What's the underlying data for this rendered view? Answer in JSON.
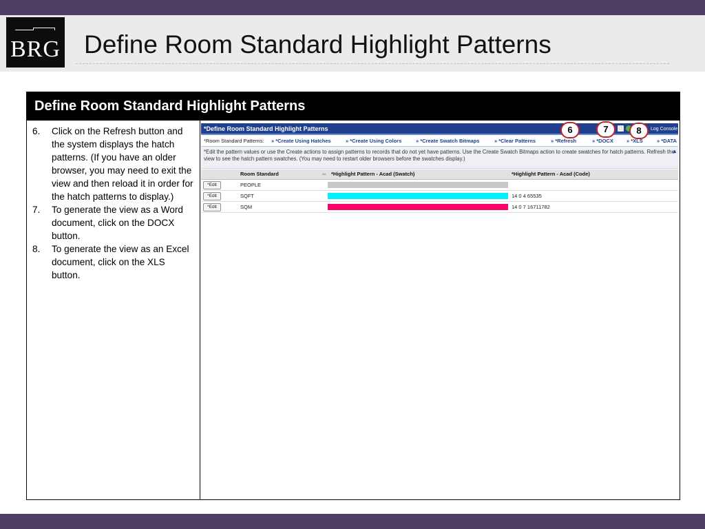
{
  "slide": {
    "title": "Define Room Standard Highlight Patterns",
    "logo_text": "BRG",
    "content_header": "Define Room Standard Highlight Patterns",
    "steps": [
      {
        "num": "6.",
        "text": "Click on the Refresh button and the system displays the hatch patterns. (If you have an older browser, you may need to exit the view and then reload it in order for the hatch patterns to display.)"
      },
      {
        "num": "7.",
        "text": "To generate the view as a Word document, click on the DOCX button."
      },
      {
        "num": "8.",
        "text": "To generate the view as an Excel document, click on the XLS button."
      }
    ]
  },
  "screenshot": {
    "title": "*Define Room Standard Highlight Patterns",
    "log_console": "Log Console",
    "actions_label": "*Room Standard Patterns:",
    "actions": [
      "» *Create Using Hatches",
      "» *Create Using Colors",
      "» *Create Swatch Bitmaps",
      "» *Clear Patterns",
      "» *Refresh",
      "» *DOCX",
      "» *XLS",
      "» *DATA"
    ],
    "description": "*Edit the pattern values or use the Create actions to assign patterns to records that do not yet have patterns. Use the Create Swatch Bitmaps action to create swatches for hatch patterns. Refresh the view to see the hatch pattern swatches. (You may need to restart older browsers before the swatches display.)",
    "columns": {
      "room_standard": "Room Standard",
      "swatch": "*Highlight Pattern - Acad (Swatch)",
      "code": "*Highlight Pattern - Acad (Code)"
    },
    "edit_label": "*Edit",
    "rows": [
      {
        "room": "PEOPLE",
        "code": "",
        "swatch_color": "#c8c8c8"
      },
      {
        "room": "SQFT",
        "code": "14 0 4 65535",
        "swatch_color": "#00f0ff"
      },
      {
        "room": "SQM",
        "code": "14 0 7 16711782",
        "swatch_color": "#ff0066"
      }
    ]
  },
  "callouts": [
    "6",
    "7",
    "8"
  ],
  "colors": {
    "band": "#4d3f63",
    "screenshot_title_bar": "#1f3f8f",
    "callout_border": "#c0232a"
  }
}
